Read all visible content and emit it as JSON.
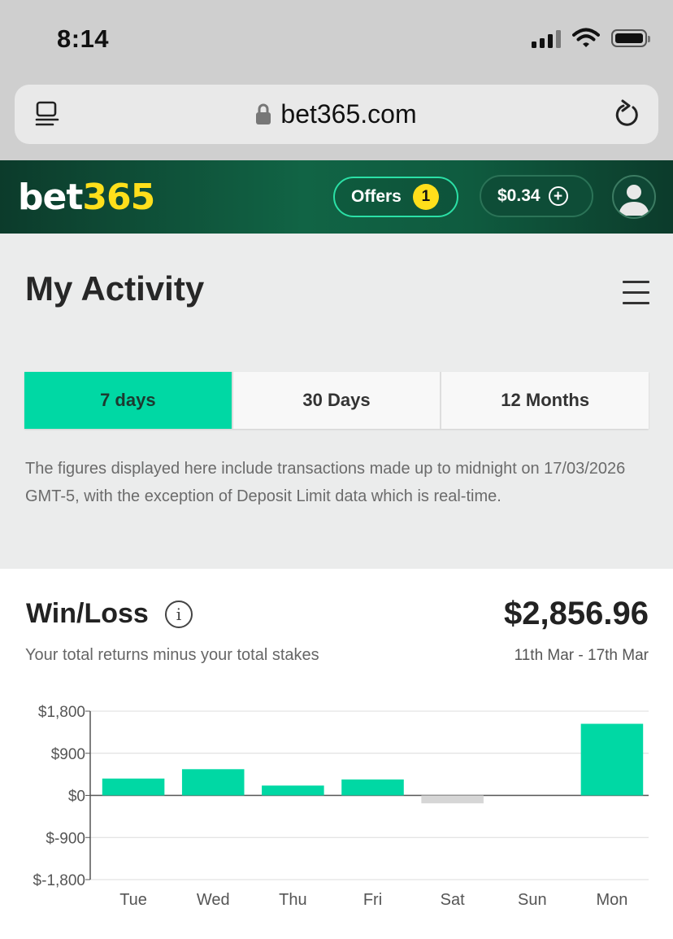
{
  "status_bar": {
    "time": "8:14"
  },
  "browser": {
    "url": "bet365.com"
  },
  "header": {
    "logo_bet": "bet",
    "logo_num": "365",
    "offers_label": "Offers",
    "offers_count": "1",
    "balance": "$0.34"
  },
  "page": {
    "title": "My Activity",
    "tabs": [
      {
        "label": "7 days",
        "active": true
      },
      {
        "label": "30 Days",
        "active": false
      },
      {
        "label": "12 Months",
        "active": false
      }
    ],
    "disclaimer": "The figures displayed here include transactions made up to midnight on 17/03/2026 GMT-5, with the exception of Deposit Limit data which is real-time."
  },
  "winloss": {
    "title": "Win/Loss",
    "info_icon": "i",
    "subtitle": "Your total returns minus your total stakes",
    "amount": "$2,856.96",
    "date_range": "11th Mar - 17th Mar"
  },
  "colors": {
    "accent": "#00d8a4",
    "negative_bar": "#d6d6d6",
    "header_green": "#116445",
    "logo_yellow": "#ffdf1b"
  },
  "chart_data": {
    "type": "bar",
    "categories": [
      "Tue",
      "Wed",
      "Thu",
      "Fri",
      "Sat",
      "Sun",
      "Mon"
    ],
    "values": [
      360,
      560,
      210,
      340,
      -170,
      0,
      1530
    ],
    "y_ticks": [
      1800,
      900,
      0,
      -900,
      -1800
    ],
    "y_tick_labels": [
      "$1,800",
      "$900",
      "$0",
      "$-900",
      "$-1,800"
    ],
    "ylim": [
      -1800,
      1800
    ],
    "grid": true,
    "positive_color": "#00d8a4",
    "negative_color": "#d6d6d6"
  }
}
